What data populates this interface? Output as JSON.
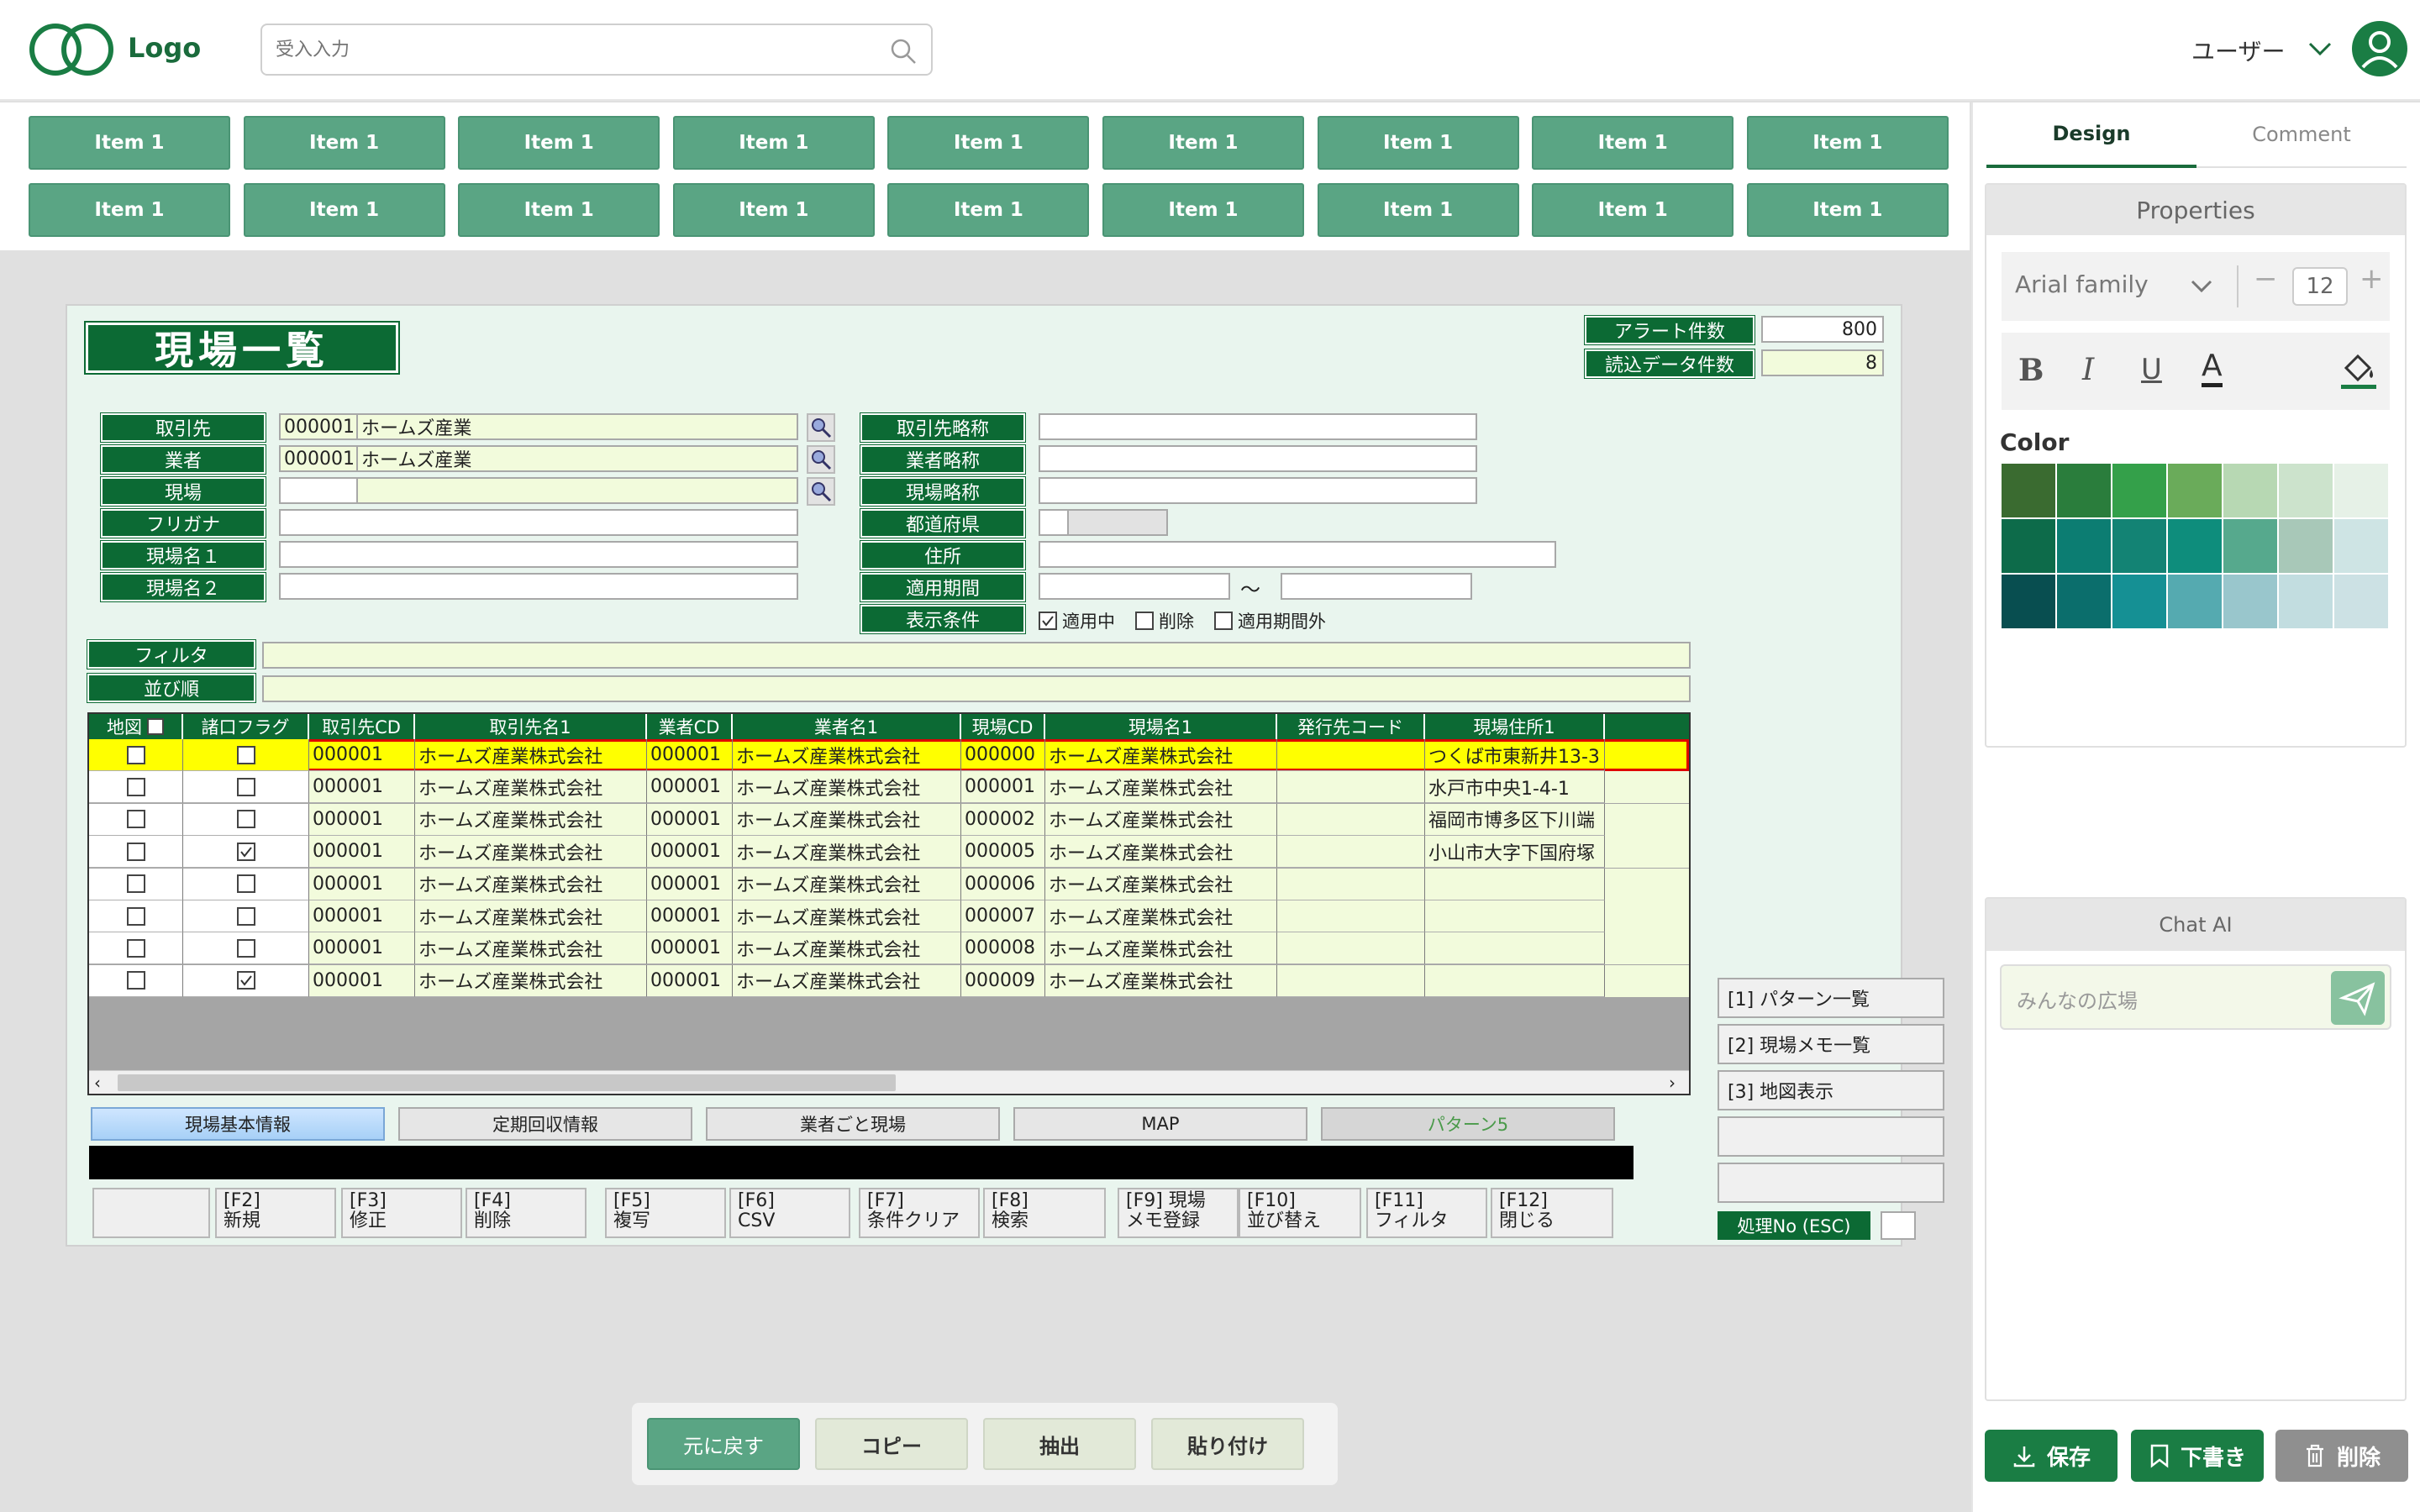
{
  "header": {
    "logo_text": "Logo",
    "search_placeholder": "受入入力",
    "user_label": "ユーザー"
  },
  "toolbar": {
    "items": [
      "Item 1",
      "Item 1",
      "Item 1",
      "Item 1",
      "Item 1",
      "Item 1",
      "Item 1",
      "Item 1",
      "Item 1",
      "Item 1",
      "Item 1",
      "Item 1",
      "Item 1",
      "Item 1",
      "Item 1",
      "Item 1",
      "Item 1",
      "Item 1"
    ]
  },
  "right_panel": {
    "tabs": [
      "Design",
      "Comment"
    ],
    "properties_title": "Properties",
    "font_family": "Arial family",
    "font_size": "12",
    "color_label": "Color",
    "swatches": [
      "#3a6b30",
      "#2a7d3c",
      "#34a04a",
      "#6aab5a",
      "#b7d8b3",
      "#cce3cc",
      "#e6f1e7",
      "#0d6b4a",
      "#0c7d72",
      "#138374",
      "#0e8d7c",
      "#56a98d",
      "#a8c8b8",
      "#cee4e4",
      "#084e50",
      "#0b6e6c",
      "#159094",
      "#55aab0",
      "#99c6cc",
      "#c2dde0",
      "#cce1e4"
    ],
    "chat_title": "Chat AI",
    "chat_placeholder": "みんなの広場",
    "save_label": "保存",
    "draft_label": "下書き",
    "delete_label": "削除"
  },
  "form": {
    "title": "現場一覧",
    "alert_label": "アラート件数",
    "alert_value": "800",
    "loaded_label": "読込データ件数",
    "loaded_value": "8",
    "left_labels": [
      "取引先",
      "業者",
      "現場",
      "フリガナ",
      "現場名１",
      "現場名２"
    ],
    "torihiki_code": "000001",
    "torihiki_name": "ホームズ産業",
    "gyosha_code": "000001",
    "gyosha_name": "ホームズ産業",
    "right_labels": [
      "取引先略称",
      "業者略称",
      "現場略称",
      "都道府県",
      "住所",
      "適用期間",
      "表示条件"
    ],
    "tilde": "～",
    "conditions": [
      "適用中",
      "削除",
      "適用期間外"
    ],
    "filter_label": "フィルタ",
    "sort_label": "並び順"
  },
  "grid": {
    "headers": [
      "地図",
      "諸口フラグ",
      "取引先CD",
      "取引先名1",
      "業者CD",
      "業者名1",
      "現場CD",
      "現場名1",
      "発行先コード",
      "現場住所1"
    ],
    "rows": [
      {
        "flag": false,
        "tcd": "000001",
        "tname": "ホームズ産業株式会社",
        "gcd": "000001",
        "gname": "ホームズ産業株式会社",
        "scd": "000000",
        "sname": "ホームズ産業株式会社",
        "addr": "つくば市東新井13-3"
      },
      {
        "flag": false,
        "tcd": "000001",
        "tname": "ホームズ産業株式会社",
        "gcd": "000001",
        "gname": "ホームズ産業株式会社",
        "scd": "000001",
        "sname": "ホームズ産業株式会社",
        "addr": "水戸市中央1-4-1"
      },
      {
        "flag": false,
        "tcd": "000001",
        "tname": "ホームズ産業株式会社",
        "gcd": "000001",
        "gname": "ホームズ産業株式会社",
        "scd": "000002",
        "sname": "ホームズ産業株式会社",
        "addr": "福岡市博多区下川端"
      },
      {
        "flag": true,
        "tcd": "000001",
        "tname": "ホームズ産業株式会社",
        "gcd": "000001",
        "gname": "ホームズ産業株式会社",
        "scd": "000005",
        "sname": "ホームズ産業株式会社",
        "addr": "小山市大字下国府塚"
      },
      {
        "flag": false,
        "tcd": "000001",
        "tname": "ホームズ産業株式会社",
        "gcd": "000001",
        "gname": "ホームズ産業株式会社",
        "scd": "000006",
        "sname": "ホームズ産業株式会社",
        "addr": ""
      },
      {
        "flag": false,
        "tcd": "000001",
        "tname": "ホームズ産業株式会社",
        "gcd": "000001",
        "gname": "ホームズ産業株式会社",
        "scd": "000007",
        "sname": "ホームズ産業株式会社",
        "addr": ""
      },
      {
        "flag": false,
        "tcd": "000001",
        "tname": "ホームズ産業株式会社",
        "gcd": "000001",
        "gname": "ホームズ産業株式会社",
        "scd": "000008",
        "sname": "ホームズ産業株式会社",
        "addr": ""
      },
      {
        "flag": true,
        "tcd": "000001",
        "tname": "ホームズ産業株式会社",
        "gcd": "000001",
        "gname": "ホームズ産業株式会社",
        "scd": "000009",
        "sname": "ホームズ産業株式会社",
        "addr": ""
      }
    ]
  },
  "sub_tabs": [
    "現場基本情報",
    "定期回収情報",
    "業者ごと現場",
    "MAP",
    "パターン5"
  ],
  "side_buttons": [
    "[1] パターン一覧",
    "[2] 現場メモ一覧",
    "[3] 地図表示",
    "",
    ""
  ],
  "process_label": "処理No (ESC)",
  "fkeys": [
    "",
    "[F2]\n新規",
    "[F3]\n修正",
    "[F4]\n削除",
    "[F5]\n複写",
    "[F6]\nCSV",
    "[F7]\n条件クリア",
    "[F8]\n検索",
    "[F9] 現場\nメモ登録",
    "[F10]\n並び替え",
    "[F11]\nフィルタ",
    "[F12]\n閉じる"
  ],
  "bottom_bar": [
    "元に戻す",
    "コピー",
    "抽出",
    "貼り付け"
  ],
  "colors": {
    "accent": "#5aa584",
    "dark_green": "#0c6a34",
    "highlight": "#ffff00"
  }
}
